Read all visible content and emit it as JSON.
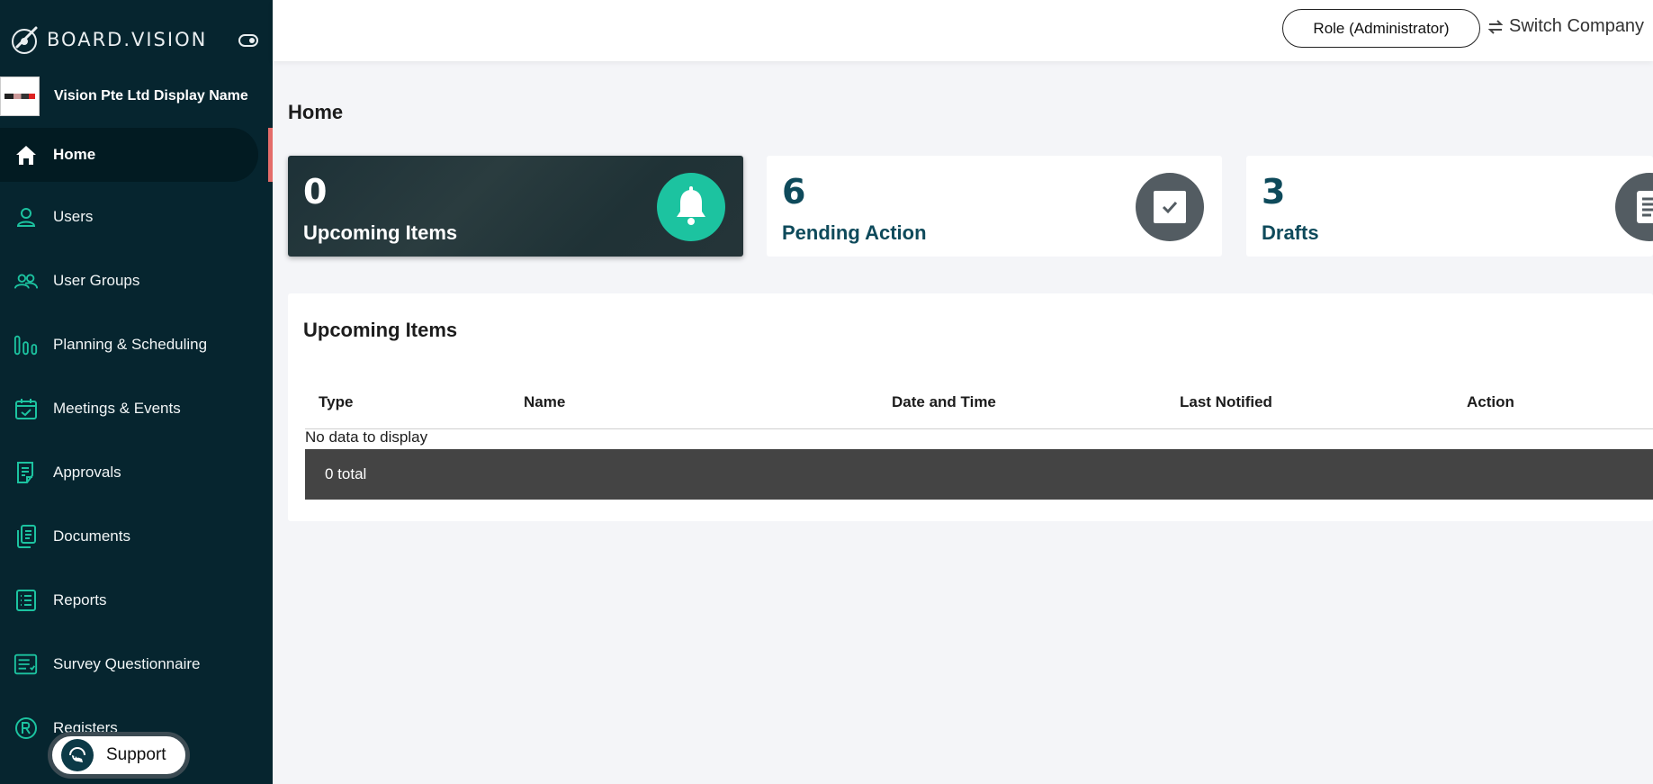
{
  "brand": {
    "name": "BOARD.VISION"
  },
  "company": {
    "name": "Vision Pte Ltd Display Name"
  },
  "sidebar": {
    "items": [
      {
        "label": "Home",
        "icon": "home-icon"
      },
      {
        "label": "Users",
        "icon": "user-icon"
      },
      {
        "label": "User Groups",
        "icon": "users-icon"
      },
      {
        "label": "Planning & Scheduling",
        "icon": "bars-icon"
      },
      {
        "label": "Meetings & Events",
        "icon": "calendar-check-icon"
      },
      {
        "label": "Approvals",
        "icon": "approval-doc-icon"
      },
      {
        "label": "Documents",
        "icon": "documents-icon"
      },
      {
        "label": "Reports",
        "icon": "list-icon"
      },
      {
        "label": "Survey Questionnaire",
        "icon": "survey-icon"
      },
      {
        "label": "Registers",
        "icon": "registered-icon"
      }
    ],
    "active": "Home"
  },
  "support": {
    "label": "Support"
  },
  "header": {
    "role_label": "Role (Administrator)",
    "switch_label": "Switch Company"
  },
  "page": {
    "title": "Home"
  },
  "cards": {
    "upcoming": {
      "count": "0",
      "label": "Upcoming Items",
      "icon": "bell-icon"
    },
    "pending": {
      "count": "6",
      "label": "Pending Action",
      "icon": "checkbox-icon"
    },
    "drafts": {
      "count": "3",
      "label": "Drafts",
      "icon": "document-icon"
    }
  },
  "upcoming_table": {
    "title": "Upcoming Items",
    "columns": [
      "Type",
      "Name",
      "Date and Time",
      "Last Notified",
      "Action"
    ],
    "empty_text": "No data to display",
    "total_text": "0 total"
  },
  "colors": {
    "sidebar_bg": "#06252f",
    "accent_teal": "#1cc3a0",
    "active_marker": "#e46d6a",
    "card_text": "#0e4a5b"
  }
}
